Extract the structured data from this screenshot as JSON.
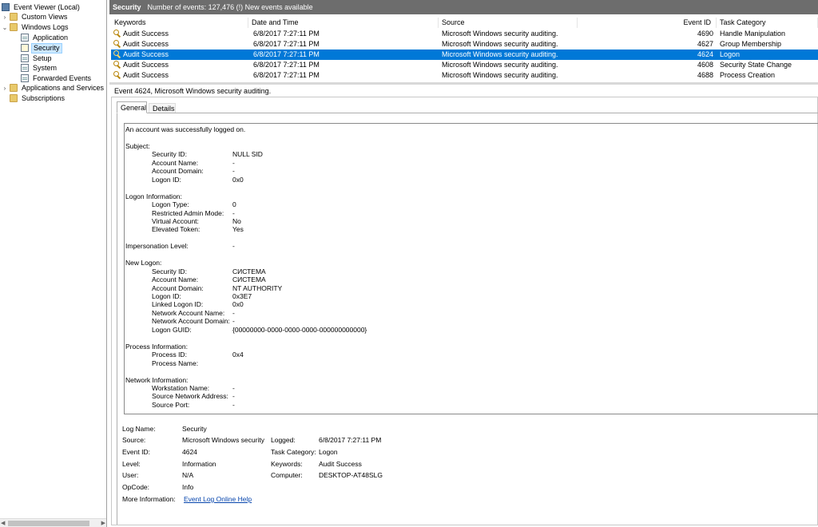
{
  "tree": {
    "root": "Event Viewer (Local)",
    "custom_views": "Custom Views",
    "windows_logs": "Windows Logs",
    "logs": [
      "Application",
      "Security",
      "Setup",
      "System",
      "Forwarded Events"
    ],
    "app_services": "Applications and Services Lo",
    "subscriptions": "Subscriptions"
  },
  "header": {
    "log_name": "Security",
    "summary": "Number of events: 127,476 (!) New events available"
  },
  "columns": [
    "Keywords",
    "Date and Time",
    "Source",
    "Event ID",
    "Task Category"
  ],
  "events": [
    {
      "keywords": "Audit Success",
      "date": "6/8/2017 7:27:11 PM",
      "source": "Microsoft Windows security auditing.",
      "id": "4690",
      "category": "Handle Manipulation",
      "selected": false
    },
    {
      "keywords": "Audit Success",
      "date": "6/8/2017 7:27:11 PM",
      "source": "Microsoft Windows security auditing.",
      "id": "4627",
      "category": "Group Membership",
      "selected": false
    },
    {
      "keywords": "Audit Success",
      "date": "6/8/2017 7:27:11 PM",
      "source": "Microsoft Windows security auditing.",
      "id": "4624",
      "category": "Logon",
      "selected": true
    },
    {
      "keywords": "Audit Success",
      "date": "6/8/2017 7:27:11 PM",
      "source": "Microsoft Windows security auditing.",
      "id": "4608",
      "category": "Security State Change",
      "selected": false
    },
    {
      "keywords": "Audit Success",
      "date": "6/8/2017 7:27:11 PM",
      "source": "Microsoft Windows security auditing.",
      "id": "4688",
      "category": "Process Creation",
      "selected": false
    }
  ],
  "detail": {
    "title": "Event 4624, Microsoft Windows security auditing.",
    "tabs": [
      "General",
      "Details"
    ],
    "message": [
      {
        "text": "An account was successfully logged on.",
        "indent": 0,
        "value": ""
      },
      {
        "text": "",
        "indent": 0,
        "value": ""
      },
      {
        "text": "Subject:",
        "indent": 0,
        "value": ""
      },
      {
        "text": "Security ID:",
        "indent": 1,
        "value": "NULL SID"
      },
      {
        "text": "Account Name:",
        "indent": 1,
        "value": "-"
      },
      {
        "text": "Account Domain:",
        "indent": 1,
        "value": "-"
      },
      {
        "text": "Logon ID:",
        "indent": 1,
        "value": "0x0"
      },
      {
        "text": "",
        "indent": 0,
        "value": ""
      },
      {
        "text": "Logon Information:",
        "indent": 0,
        "value": ""
      },
      {
        "text": "Logon Type:",
        "indent": 1,
        "value": "0"
      },
      {
        "text": "Restricted Admin Mode:",
        "indent": 1,
        "value": "-"
      },
      {
        "text": "Virtual Account:",
        "indent": 1,
        "value": "No"
      },
      {
        "text": "Elevated Token:",
        "indent": 1,
        "value": "Yes"
      },
      {
        "text": "",
        "indent": 0,
        "value": ""
      },
      {
        "text": "Impersonation Level:",
        "indent": 0,
        "value": "-"
      },
      {
        "text": "",
        "indent": 0,
        "value": ""
      },
      {
        "text": "New Logon:",
        "indent": 0,
        "value": ""
      },
      {
        "text": "Security ID:",
        "indent": 1,
        "value": "СИСТЕМА"
      },
      {
        "text": "Account Name:",
        "indent": 1,
        "value": "СИСТЕМА"
      },
      {
        "text": "Account Domain:",
        "indent": 1,
        "value": "NT AUTHORITY"
      },
      {
        "text": "Logon ID:",
        "indent": 1,
        "value": "0x3E7"
      },
      {
        "text": "Linked Logon ID:",
        "indent": 1,
        "value": "0x0"
      },
      {
        "text": "Network Account Name:",
        "indent": 1,
        "value": "-"
      },
      {
        "text": "Network Account Domain:",
        "indent": 1,
        "value": "-"
      },
      {
        "text": "Logon GUID:",
        "indent": 1,
        "value": "{00000000-0000-0000-0000-000000000000}"
      },
      {
        "text": "",
        "indent": 0,
        "value": ""
      },
      {
        "text": "Process Information:",
        "indent": 0,
        "value": ""
      },
      {
        "text": "Process ID:",
        "indent": 1,
        "value": "0x4"
      },
      {
        "text": "Process Name:",
        "indent": 1,
        "value": ""
      },
      {
        "text": "",
        "indent": 0,
        "value": ""
      },
      {
        "text": "Network Information:",
        "indent": 0,
        "value": ""
      },
      {
        "text": "Workstation Name:",
        "indent": 1,
        "value": "-"
      },
      {
        "text": "Source Network Address:",
        "indent": 1,
        "value": "-"
      },
      {
        "text": "Source Port:",
        "indent": 1,
        "value": "-"
      }
    ],
    "props": {
      "log_name_label": "Log Name:",
      "log_name": "Security",
      "source_label": "Source:",
      "source": "Microsoft Windows security",
      "logged_label": "Logged:",
      "logged": "6/8/2017 7:27:11 PM",
      "event_id_label": "Event ID:",
      "event_id": "4624",
      "task_category_label": "Task Category:",
      "task_category": "Logon",
      "level_label": "Level:",
      "level": "Information",
      "keywords_label": "Keywords:",
      "keywords": "Audit Success",
      "user_label": "User:",
      "user": "N/A",
      "computer_label": "Computer:",
      "computer": "DESKTOP-AT48SLG",
      "opcode_label": "OpCode:",
      "opcode": "Info",
      "more_info_label": "More Information:",
      "more_info_link": "Event Log Online Help"
    }
  },
  "colors": {
    "selection": "#0078d7",
    "title_bar": "#6d6d6d",
    "tree_selection": "#cce8ff",
    "link": "#0645ad"
  }
}
